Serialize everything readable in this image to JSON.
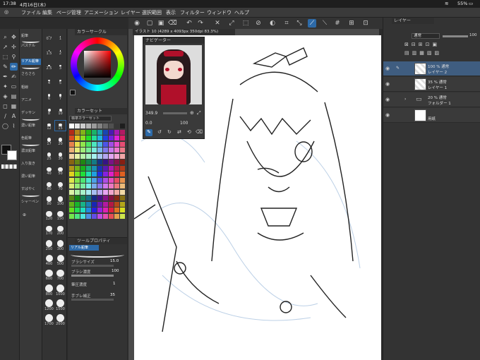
{
  "status": {
    "time": "17:38",
    "date": "4月16日(木)",
    "battery": "55%"
  },
  "menu": [
    "ファイル",
    "編集",
    "ページ管理",
    "アニメーション",
    "レイヤー",
    "選択範囲",
    "表示",
    "フィルター",
    "ウィンドウ",
    "ヘルプ"
  ],
  "document_tab": "イラスト 10 (4289 x 4093px 350dpi 83.3%)",
  "subtools": [
    "鉛筆",
    "パステル",
    "リアル鉛筆",
    "さらさら",
    "粗線",
    "アニメ",
    "デッサン",
    "濃い鉛筆",
    "色鉛筆",
    "濃淡鉛筆",
    "入り抜き",
    "濃い鉛筆",
    "すばやく",
    "シャーペン"
  ],
  "brush_sizes": [
    "0.7",
    "1",
    "1.5",
    "2",
    "2.5",
    "3",
    "4",
    "5",
    "6",
    "7",
    "8",
    "10",
    "12",
    "15",
    "17",
    "20",
    "25",
    "30",
    "40",
    "50",
    "60",
    "70",
    "80",
    "100",
    "120",
    "150",
    "170",
    "200",
    "250",
    "300",
    "400",
    "500",
    "600",
    "700",
    "800",
    "1000",
    "1200",
    "1500",
    "1700",
    "2000"
  ],
  "color_circle": {
    "title": "カラーサークル"
  },
  "color_set": {
    "title": "カラーセット",
    "preset": "標準カラーセット"
  },
  "navigator": {
    "title": "ナビゲーター",
    "zoom": "349.9",
    "angle": "0.0",
    "rotation": "100"
  },
  "tool_property": {
    "title": "ツールプロパティ",
    "subtool": "リアル鉛筆",
    "rows": [
      {
        "label": "ブラシサイズ",
        "value": "15.0"
      },
      {
        "label": "ブラシ濃度",
        "value": "100"
      },
      {
        "label": "筆圧濃度",
        "value": "1"
      },
      {
        "label": "手ブレ補正",
        "value": "35"
      }
    ]
  },
  "layer_panel": {
    "title": "レイヤー",
    "blend_mode": "通常",
    "opacity": "100",
    "layers": [
      {
        "percent": "100 %",
        "mode": "通常",
        "name": "レイヤー 2"
      },
      {
        "percent": "35 %",
        "mode": "通常",
        "name": "レイヤー 1"
      },
      {
        "percent": "20 %",
        "mode": "通常",
        "name": "フォルダー 1"
      },
      {
        "percent": "",
        "mode": "",
        "name": "用紙"
      }
    ]
  },
  "colors": {
    "accent": "#2d6aa8",
    "panel_bg": "#3a3a3a",
    "main_color": "#111111",
    "sub_color": "#ffffff"
  }
}
